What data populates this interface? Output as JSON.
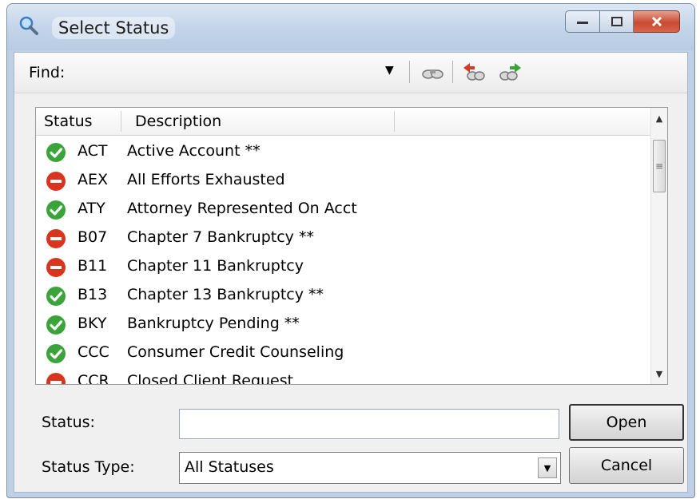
{
  "window": {
    "title": "Select Status",
    "icon": "magnifier-icon"
  },
  "find": {
    "label": "Find:",
    "tools": [
      "find-icon",
      "find-previous-icon",
      "find-next-icon"
    ]
  },
  "list": {
    "columns": [
      "Status",
      "Description"
    ],
    "rows": [
      {
        "code": "ACT",
        "description": "Active Account **",
        "icon": "check-icon"
      },
      {
        "code": "AEX",
        "description": "All Efforts Exhausted",
        "icon": "no-entry-icon"
      },
      {
        "code": "ATY",
        "description": "Attorney Represented On Acct",
        "icon": "check-icon"
      },
      {
        "code": "B07",
        "description": "Chapter 7 Bankruptcy **",
        "icon": "no-entry-icon"
      },
      {
        "code": "B11",
        "description": "Chapter 11 Bankruptcy",
        "icon": "no-entry-icon"
      },
      {
        "code": "B13",
        "description": "Chapter 13 Bankruptcy **",
        "icon": "check-icon"
      },
      {
        "code": "BKY",
        "description": "Bankruptcy Pending **",
        "icon": "check-icon"
      },
      {
        "code": "CCC",
        "description": "Consumer Credit Counseling",
        "icon": "check-icon"
      },
      {
        "code": "CCR",
        "description": "Closed Client Request",
        "icon": "no-entry-icon"
      }
    ]
  },
  "form": {
    "status_label": "Status:",
    "status_value": "",
    "status_type_label": "Status Type:",
    "status_type_value": "All Statuses"
  },
  "buttons": {
    "open": "Open",
    "cancel": "Cancel"
  },
  "colors": {
    "ok": "#3aa33a",
    "blocked": "#d8351e"
  }
}
